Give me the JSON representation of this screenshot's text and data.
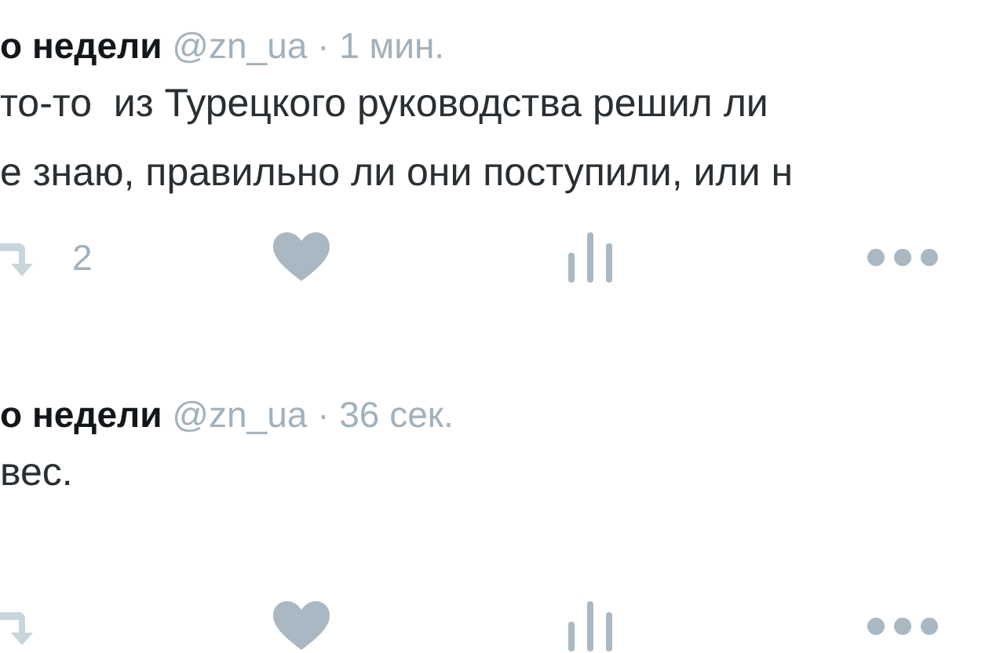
{
  "tweets": [
    {
      "author": "о недели",
      "handle": "@zn_ua",
      "separator": "·",
      "time": "1 мин.",
      "lines": [
        "то-то  из Турецкого руководства решил ли",
        "е знаю, правильно ли они поступили, или н"
      ],
      "retweet_count": "2"
    },
    {
      "author": "о недели",
      "handle": "@zn_ua",
      "separator": "·",
      "time": "36 сек.",
      "lines": [
        "вес."
      ]
    }
  ]
}
